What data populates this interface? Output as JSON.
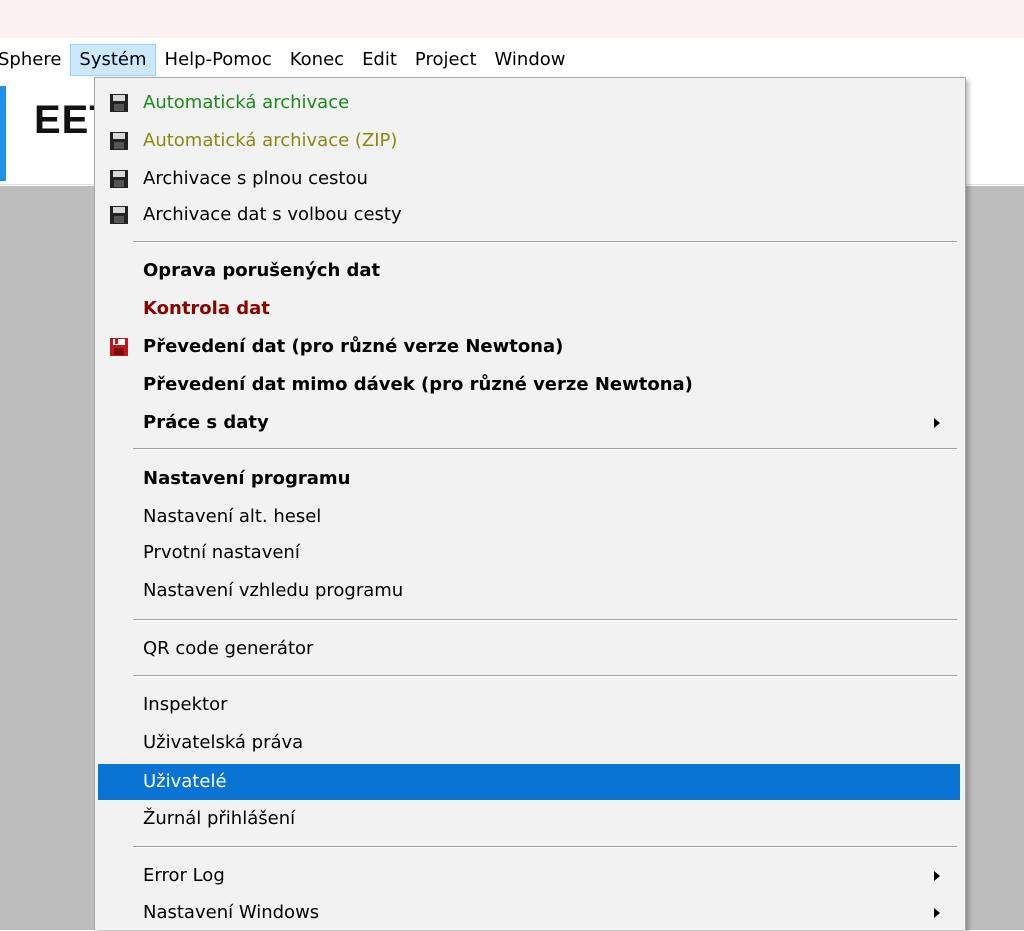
{
  "menubar": {
    "items": [
      "Sphere",
      "Systém",
      "Help-Pomoc",
      "Konec",
      "Edit",
      "Project",
      "Window"
    ]
  },
  "logo": {
    "text": "EET"
  },
  "menu": {
    "items": [
      {
        "label": "Automatická archivace",
        "color": "#1a8a1a",
        "bold": true,
        "icon": "floppy-disk-icon"
      },
      {
        "label": "Automatická archivace (ZIP)",
        "color": "#8a8a10",
        "bold": true,
        "icon": "floppy-disk-icon"
      },
      {
        "label": "Archivace s plnou cestou",
        "color": "#000000",
        "bold": false,
        "icon": "floppy-disk-icon"
      },
      {
        "label": "Archivace dat s volbou cesty",
        "color": "#000000",
        "bold": false,
        "icon": "floppy-disk-icon"
      },
      {
        "label": "Oprava porušených dat",
        "color": "#000000",
        "bold": true
      },
      {
        "label": "Kontrola dat",
        "color": "#8b0000",
        "bold": true
      },
      {
        "label": "Převedení dat (pro různé verze Newtona)",
        "color": "#000000",
        "bold": true,
        "icon": "red-floppy-disk-icon"
      },
      {
        "label": "Převedení dat mimo dávek (pro různé verze Newtona)",
        "color": "#000000",
        "bold": true
      },
      {
        "label": "Práce s daty",
        "color": "#000000",
        "bold": true,
        "submenu": true
      },
      {
        "label": "Nastavení programu",
        "color": "#000000",
        "bold": true
      },
      {
        "label": "Nastavení alt. hesel",
        "color": "#000000",
        "bold": false
      },
      {
        "label": "Prvotní nastavení",
        "color": "#000000",
        "bold": false
      },
      {
        "label": "Nastavení vzhledu programu",
        "color": "#000000",
        "bold": false
      },
      {
        "label": "QR code generátor",
        "color": "#000000",
        "bold": false
      },
      {
        "label": "Inspektor",
        "color": "#000000",
        "bold": false
      },
      {
        "label": "Uživatelská práva",
        "color": "#000000",
        "bold": false
      },
      {
        "label": "Uživatelé",
        "color": "#ffffff",
        "bold": false,
        "highlighted": true
      },
      {
        "label": "Žurnál přihlášení",
        "color": "#000000",
        "bold": false
      },
      {
        "label": "Error Log",
        "color": "#000000",
        "bold": false,
        "submenu": true
      },
      {
        "label": "Nastavení Windows",
        "color": "#000000",
        "bold": false,
        "submenu": true
      }
    ]
  },
  "colors": {
    "highlight": "#0a74d4",
    "menu_bg": "#f2f2f2",
    "workspace": "#bdbdbd",
    "logo_border": "#1e90e6"
  }
}
